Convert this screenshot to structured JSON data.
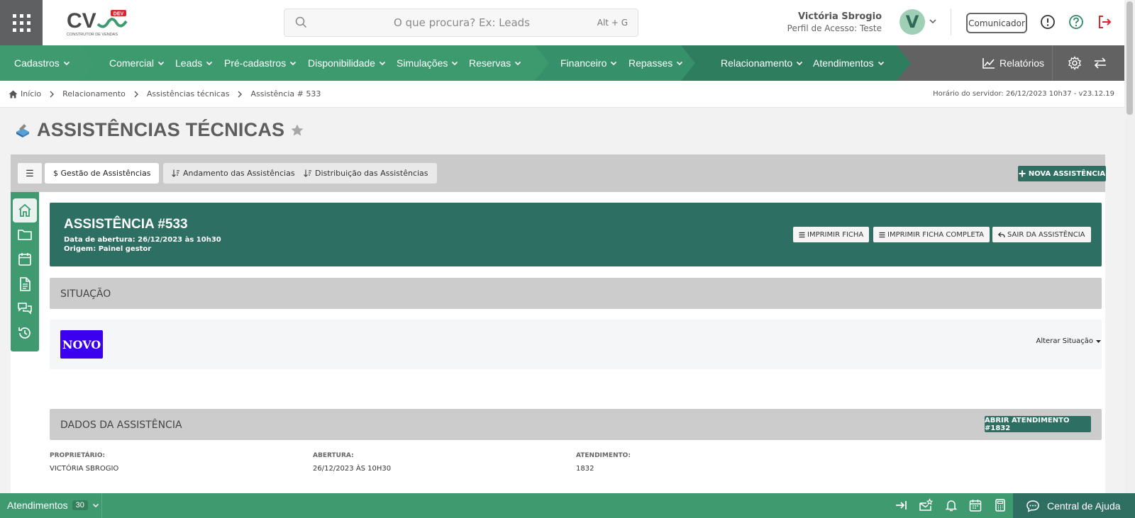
{
  "header": {
    "logo_text": "CV",
    "logo_badge": "DEV",
    "logo_tagline": "CONSTRUTOR DE VENDAS",
    "search_placeholder": "O que procura? Ex: Leads",
    "search_shortcut": "Alt + G",
    "user_name": "Victória Sbrogio",
    "user_profile": "Perfil de Acesso: Teste",
    "avatar_letter": "V",
    "comunicador_label": "Comunicador"
  },
  "nav": {
    "items": [
      {
        "label": "Cadastros"
      },
      {
        "label": "Comercial"
      },
      {
        "label": "Leads"
      },
      {
        "label": "Pré-cadastros"
      },
      {
        "label": "Disponibilidade"
      },
      {
        "label": "Simulações"
      },
      {
        "label": "Reservas"
      },
      {
        "label": "Financeiro"
      },
      {
        "label": "Repasses"
      },
      {
        "label": "Relacionamento"
      },
      {
        "label": "Atendimentos"
      }
    ],
    "reports_label": "Relatórios"
  },
  "breadcrumb": {
    "items": [
      "Início",
      "Relacionamento",
      "Assistências técnicas",
      "Assistência # 533"
    ],
    "server_time": "Horário do servidor: 26/12/2023 10h37 - v23.12.19"
  },
  "page": {
    "title": "ASSISTÊNCIAS TÉCNICAS"
  },
  "tabs": {
    "menu_icon": "☰",
    "items": [
      {
        "label": "$ Gestão de Assistências"
      },
      {
        "label": "Andamento das Assistências"
      },
      {
        "label": "Distribuição das Assistências"
      }
    ],
    "new_button": "NOVA ASSISTÊNCIA"
  },
  "assistance": {
    "title": "ASSISTÊNCIA #533",
    "opened": "Data de abertura: 26/12/2023 às 10h30",
    "origin": "Origem: Painel gestor",
    "print_label": "IMPRIMIR FICHA",
    "print_full_label": "IMPRIMIR FICHA COMPLETA",
    "exit_label": "SAIR DA ASSISTÊNCIA"
  },
  "situation": {
    "section_title": "SITUAÇÃO",
    "status": "NOVO",
    "status_color": "#3a00ef",
    "change_label": "Alterar Situação"
  },
  "details": {
    "section_title": "DADOS DA ASSISTÊNCIA",
    "open_attendance_label": "ABRIR ATENDIMENTO #1832",
    "fields": [
      {
        "label": "PROPRIETÁRIO:",
        "value": "VICTÓRIA SBROGIO"
      },
      {
        "label": "ABERTURA:",
        "value": "26/12/2023 ÀS 10H30"
      },
      {
        "label": "ATENDIMENTO:",
        "value": "1832"
      }
    ]
  },
  "bottom": {
    "attendances_label": "Atendimentos",
    "attendances_count": "30",
    "help_label": "Central de Ajuda"
  },
  "colors": {
    "brand_green": "#3f9a70",
    "dark_teal": "#2e6f63",
    "nav_gray": "#626262",
    "exit_red": "#e0262a"
  }
}
